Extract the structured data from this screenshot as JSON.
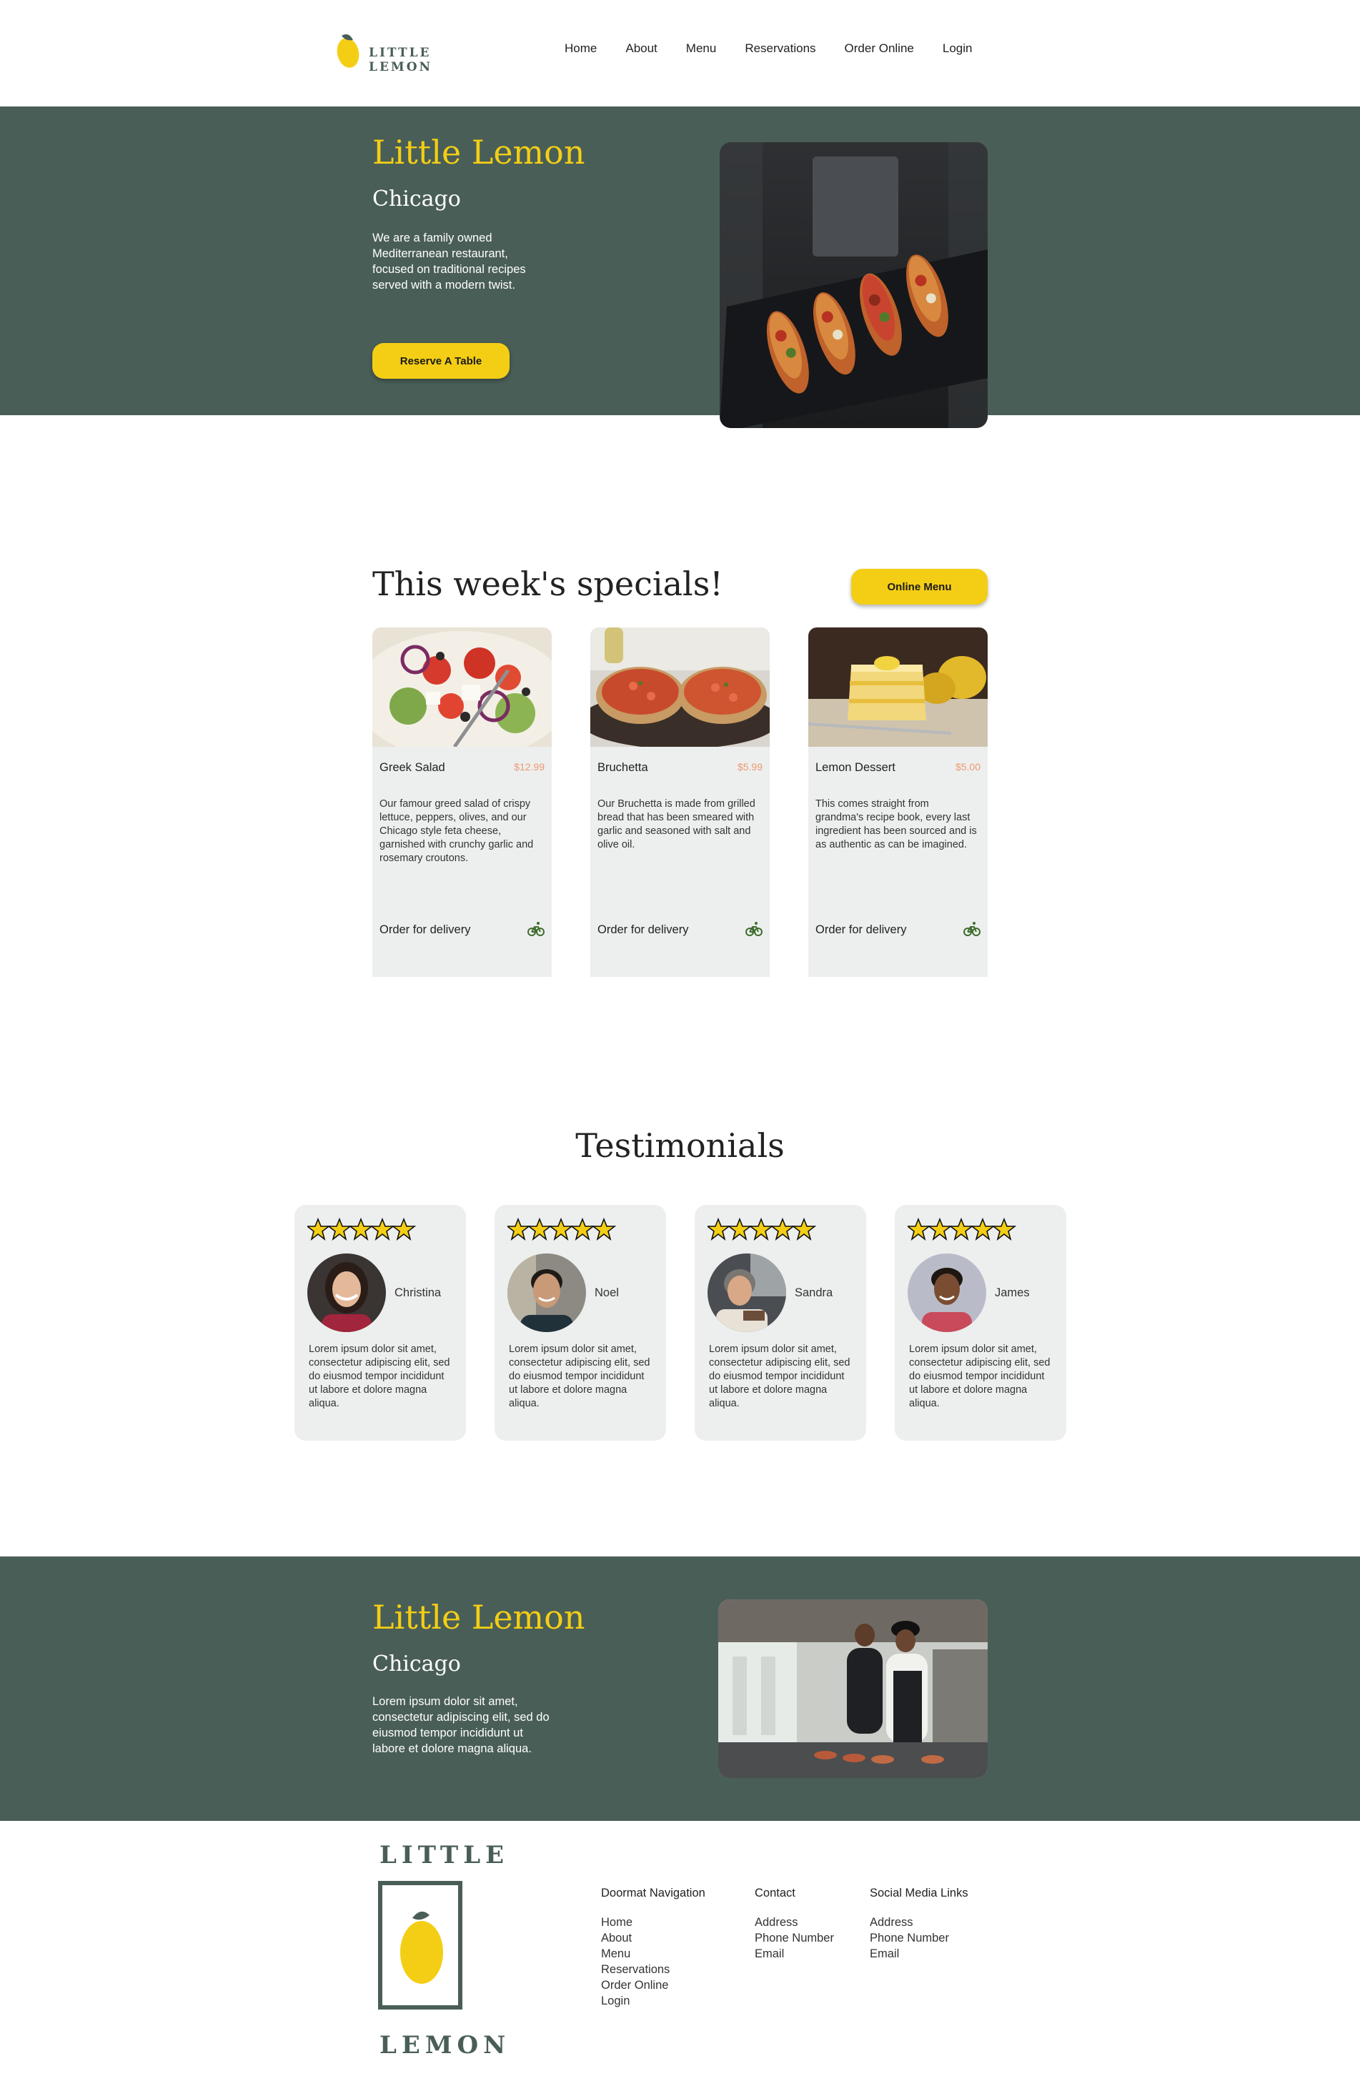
{
  "header": {
    "logo_text": "LITTLE LEMON",
    "nav": [
      "Home",
      "About",
      "Menu",
      "Reservations",
      "Order Online",
      "Login"
    ]
  },
  "hero": {
    "title": "Little Lemon",
    "subtitle": "Chicago",
    "description": "We are a family owned Mediterranean restaurant, focused on traditional recipes served with a modern twist.",
    "button": "Reserve A Table"
  },
  "specials": {
    "heading": "This week's specials!",
    "button": "Online Menu",
    "items": [
      {
        "name": "Greek Salad",
        "price": "$12.99",
        "description": "Our famour greed salad of crispy lettuce, peppers, olives, and our Chicago style feta cheese, garnished with crunchy garlic and rosemary croutons.",
        "order": "Order for delivery"
      },
      {
        "name": "Bruchetta",
        "price": "$5.99",
        "description": "Our Bruchetta is made from grilled bread that has been smeared with garlic and seasoned with salt and olive oil.",
        "order": "Order for delivery"
      },
      {
        "name": "Lemon Dessert",
        "price": "$5.00",
        "description": "This comes straight from grandma's recipe book, every last ingredient has been sourced and is as authentic as can be imagined.",
        "order": "Order for delivery"
      }
    ]
  },
  "testimonials": {
    "heading": "Testimonials",
    "rating": 5,
    "items": [
      {
        "name": "Christina",
        "quote": "Lorem ipsum dolor sit amet, consectetur adipiscing elit, sed do eiusmod tempor incididunt ut labore et dolore magna aliqua."
      },
      {
        "name": "Noel",
        "quote": "Lorem ipsum dolor sit amet, consectetur adipiscing elit, sed do eiusmod tempor incididunt ut labore et dolore magna aliqua."
      },
      {
        "name": "Sandra",
        "quote": "Lorem ipsum dolor sit amet, consectetur adipiscing elit, sed do eiusmod tempor incididunt ut labore et dolore magna aliqua."
      },
      {
        "name": "James",
        "quote": "Lorem ipsum dolor sit amet, consectetur adipiscing elit, sed do eiusmod tempor incididunt ut labore et dolore magna aliqua."
      }
    ]
  },
  "about": {
    "title": "Little Lemon",
    "subtitle": "Chicago",
    "description": "Lorem ipsum dolor sit amet, consectetur adipiscing elit, sed do eiusmod tempor incididunt ut labore et dolore magna aliqua."
  },
  "footer": {
    "logo_top": "LITTLE",
    "logo_bottom": "LEMON",
    "doormat": {
      "heading": "Doormat Navigation",
      "links": [
        "Home",
        "About",
        "Menu",
        "Reservations",
        "Order Online",
        "Login"
      ]
    },
    "contact": {
      "heading": "Contact",
      "links": [
        "Address",
        "Phone Number",
        "Email"
      ]
    },
    "social": {
      "heading": "Social Media Links",
      "links": [
        "Address",
        "Phone Number",
        "Email"
      ]
    }
  },
  "colors": {
    "primary_green": "#495e57",
    "primary_yellow": "#f4ce14",
    "card_gray": "#edefee",
    "price_salmon": "#ee9972"
  },
  "icons": [
    "lemon-logo-icon",
    "bicycle-icon",
    "star-icon"
  ]
}
